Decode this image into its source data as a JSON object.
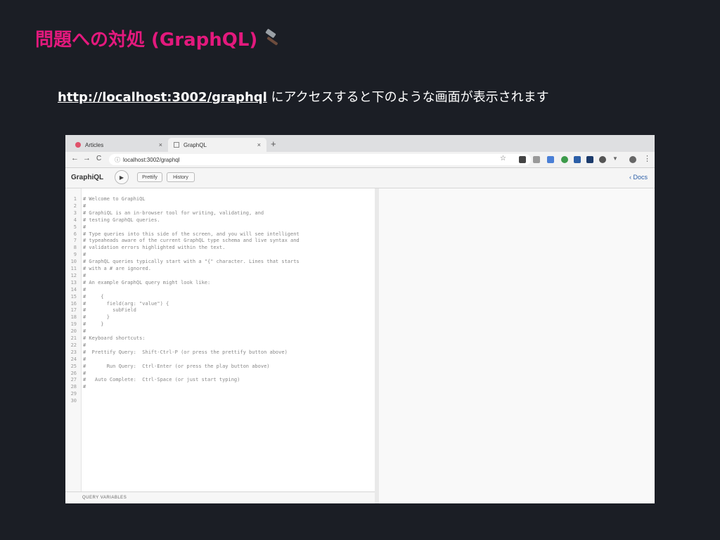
{
  "slide": {
    "title": "問題への対処 (GraphQL)",
    "subtitle_url": "http://localhost:3002/graphql",
    "subtitle_rest": " にアクセスすると下のような画面が表示されます",
    "accent_color": "#e3197d"
  },
  "browser": {
    "tabs": [
      {
        "label": "Articles",
        "close": "×"
      },
      {
        "label": "GraphQL",
        "close": "×"
      }
    ],
    "new_tab": "+",
    "address": "localhost:3002/graphql",
    "nav": {
      "back": "←",
      "forward": "→",
      "reload": "C"
    }
  },
  "graphiql": {
    "logo": "GraphiQL",
    "play": "▶",
    "prettify": "Prettify",
    "history": "History",
    "docs": "Docs",
    "query_variables": "QUERY VARIABLES",
    "lines": [
      "# Welcome to GraphiQL",
      "#",
      "# GraphiQL is an in-browser tool for writing, validating, and",
      "# testing GraphQL queries.",
      "#",
      "# Type queries into this side of the screen, and you will see intelligent",
      "# typeaheads aware of the current GraphQL type schema and live syntax and",
      "# validation errors highlighted within the text.",
      "#",
      "# GraphQL queries typically start with a \"{\" character. Lines that starts",
      "# with a # are ignored.",
      "#",
      "# An example GraphQL query might look like:",
      "#",
      "#     {",
      "#       field(arg: \"value\") {",
      "#         subField",
      "#       }",
      "#     }",
      "#",
      "# Keyboard shortcuts:",
      "#",
      "#  Prettify Query:  Shift-Ctrl-P (or press the prettify button above)",
      "#",
      "#       Run Query:  Ctrl-Enter (or press the play button above)",
      "#",
      "#   Auto Complete:  Ctrl-Space (or just start typing)",
      "#",
      "",
      ""
    ]
  }
}
